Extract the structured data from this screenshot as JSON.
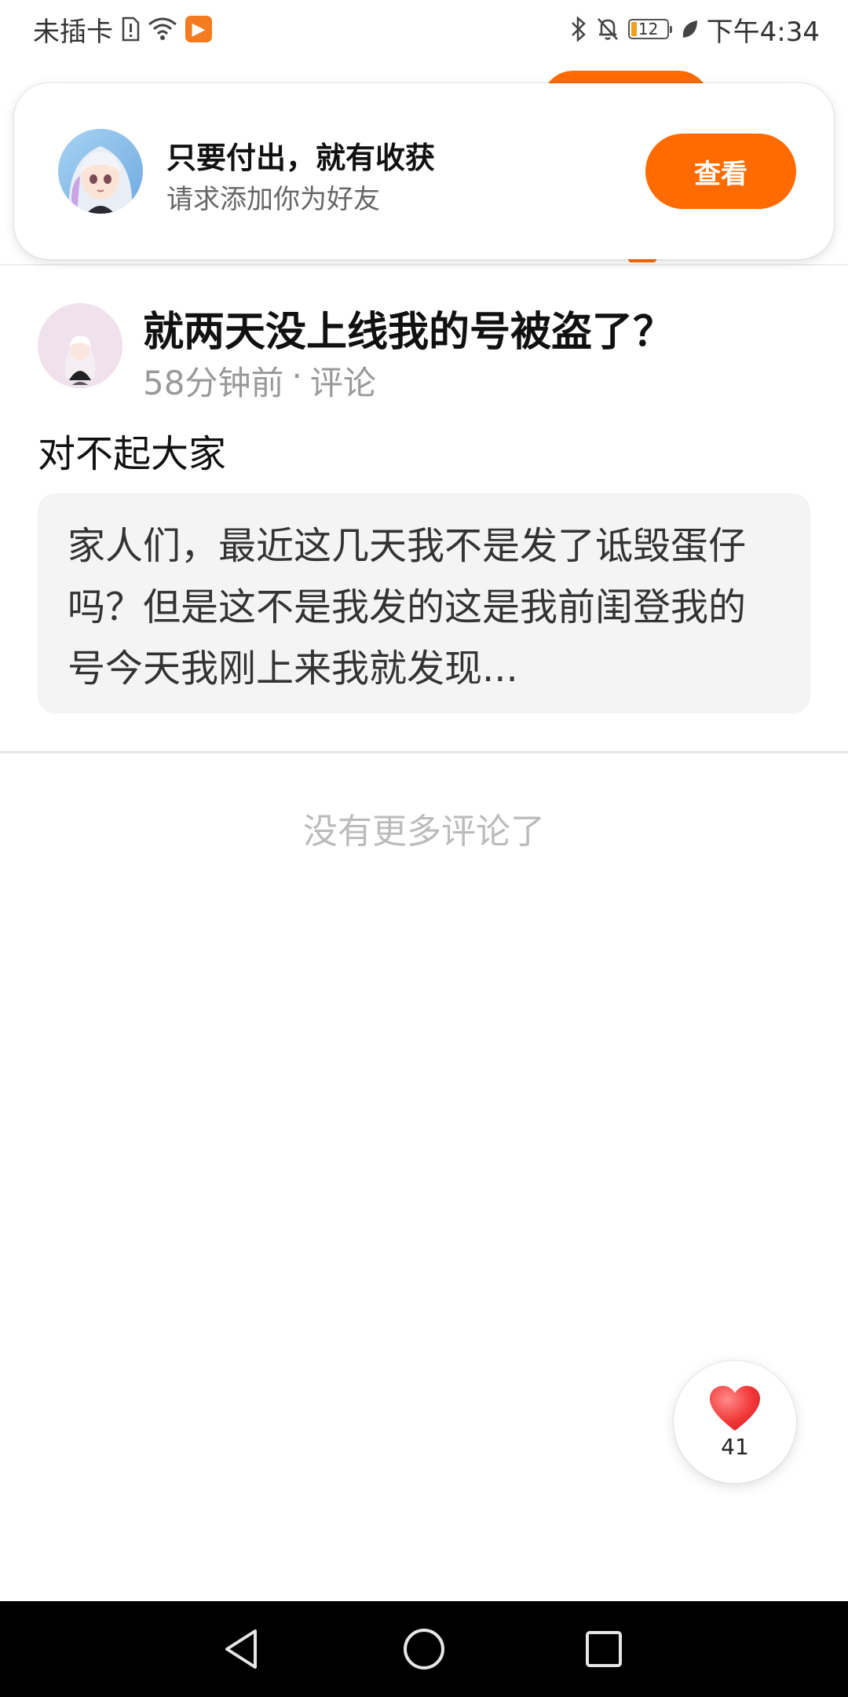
{
  "status_bar": {
    "carrier": "未插卡",
    "battery_level": "12",
    "time": "下午4:34",
    "icons": [
      "sim-alert-icon",
      "wifi-icon",
      "app-notification-icon",
      "bluetooth-icon",
      "mute-bell-icon",
      "battery-icon",
      "leaf-icon"
    ]
  },
  "friend_request": {
    "title": "只要付出，就有收获",
    "subtitle": "请求添加你为好友",
    "action_label": "查看"
  },
  "post": {
    "title": "就两天没上线我的号被盗了？",
    "time_ago": "58分钟前",
    "separator": "·",
    "category": "评论",
    "subtitle": "对不起大家",
    "quote": "家人们，最近这几天我不是发了诋毁蛋仔吗？但是这不是我发的这是我前闺登我的号今天我刚上来我就发现..."
  },
  "comments": {
    "empty_text": "没有更多评论了"
  },
  "like": {
    "count": "41"
  },
  "colors": {
    "accent": "#ff6b00",
    "like_red": "#f23a3a"
  }
}
